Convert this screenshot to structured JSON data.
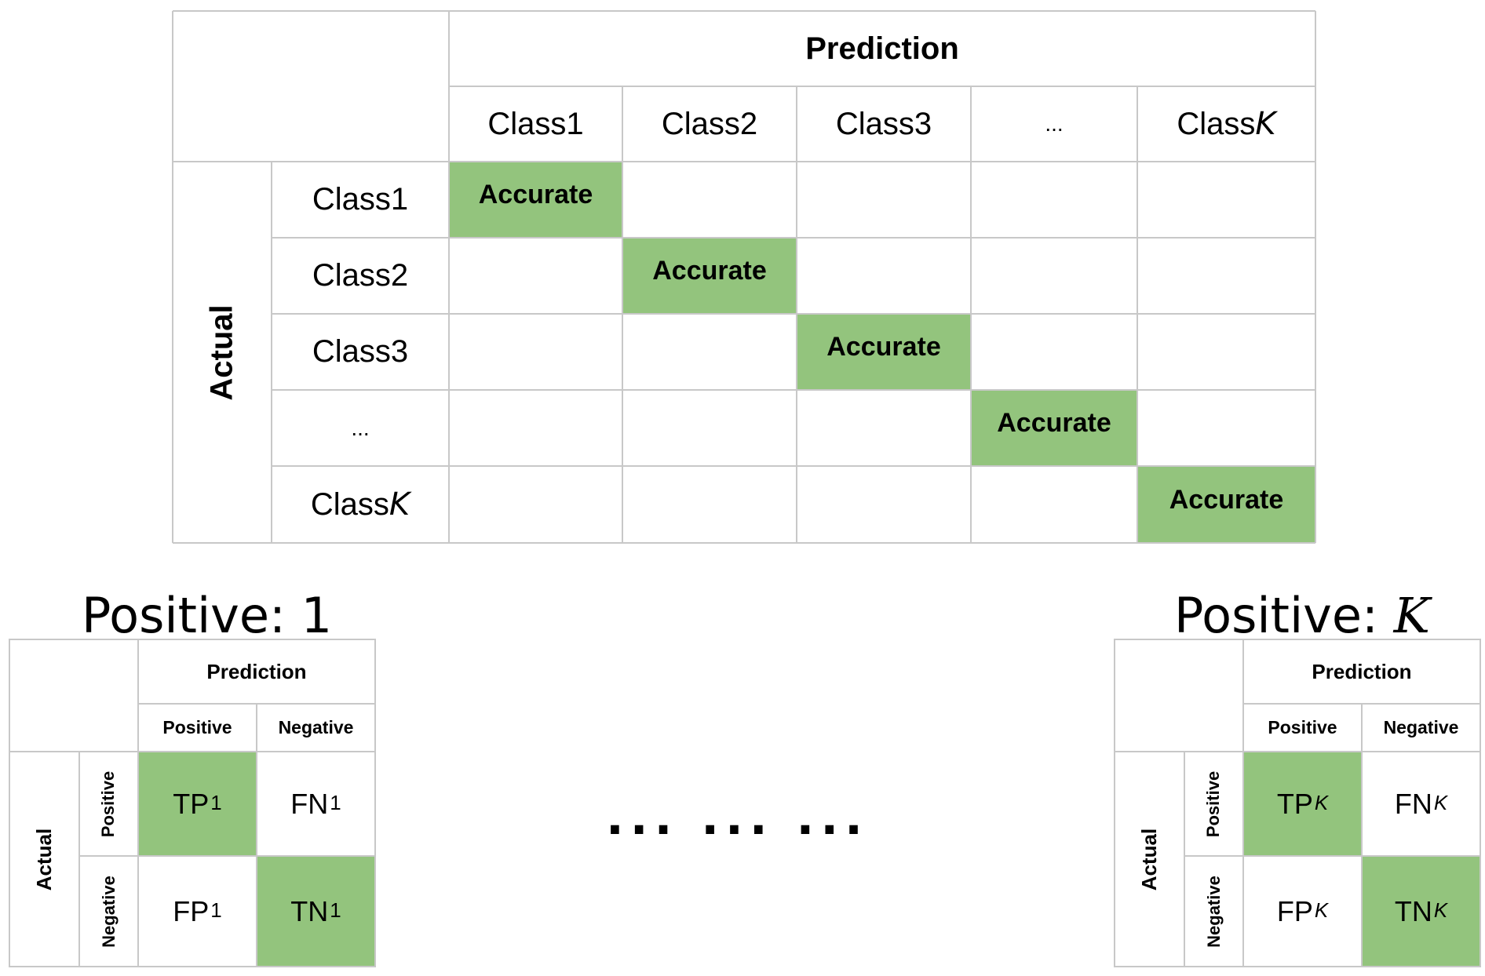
{
  "main_matrix": {
    "prediction_header": "Prediction",
    "actual_header": "Actual",
    "col_headers": [
      {
        "text": "Class ",
        "var": "1"
      },
      {
        "text": "Class ",
        "var": "2"
      },
      {
        "text": "Class ",
        "var": "3"
      },
      {
        "text": "...",
        "var": ""
      },
      {
        "text": "Class ",
        "var": "K"
      }
    ],
    "row_headers": [
      {
        "text": "Class ",
        "var": "1"
      },
      {
        "text": "Class ",
        "var": "2"
      },
      {
        "text": "Class ",
        "var": "3"
      },
      {
        "text": "...",
        "var": ""
      },
      {
        "text": "Class ",
        "var": "K"
      }
    ],
    "diagonal_label": "Accurate",
    "highlight_color": "#93c47d"
  },
  "left_panel": {
    "title_prefix": "Positive: ",
    "title_var": "1",
    "prediction_header": "Prediction",
    "col_positive": "Positive",
    "col_negative": "Negative",
    "actual_header": "Actual",
    "row_positive": "Positive",
    "row_negative": "Negative",
    "tp": "TP",
    "fn": "FN",
    "fp": "FP",
    "tn": "TN",
    "subscript": "1"
  },
  "right_panel": {
    "title_prefix": "Positive: ",
    "title_var": "K",
    "prediction_header": "Prediction",
    "col_positive": "Positive",
    "col_negative": "Negative",
    "actual_header": "Actual",
    "row_positive": "Positive",
    "row_negative": "Negative",
    "tp": "TP",
    "fn": "FN",
    "fp": "FP",
    "tn": "TN",
    "subscript": "K"
  },
  "ellipsis": "... ... ..."
}
